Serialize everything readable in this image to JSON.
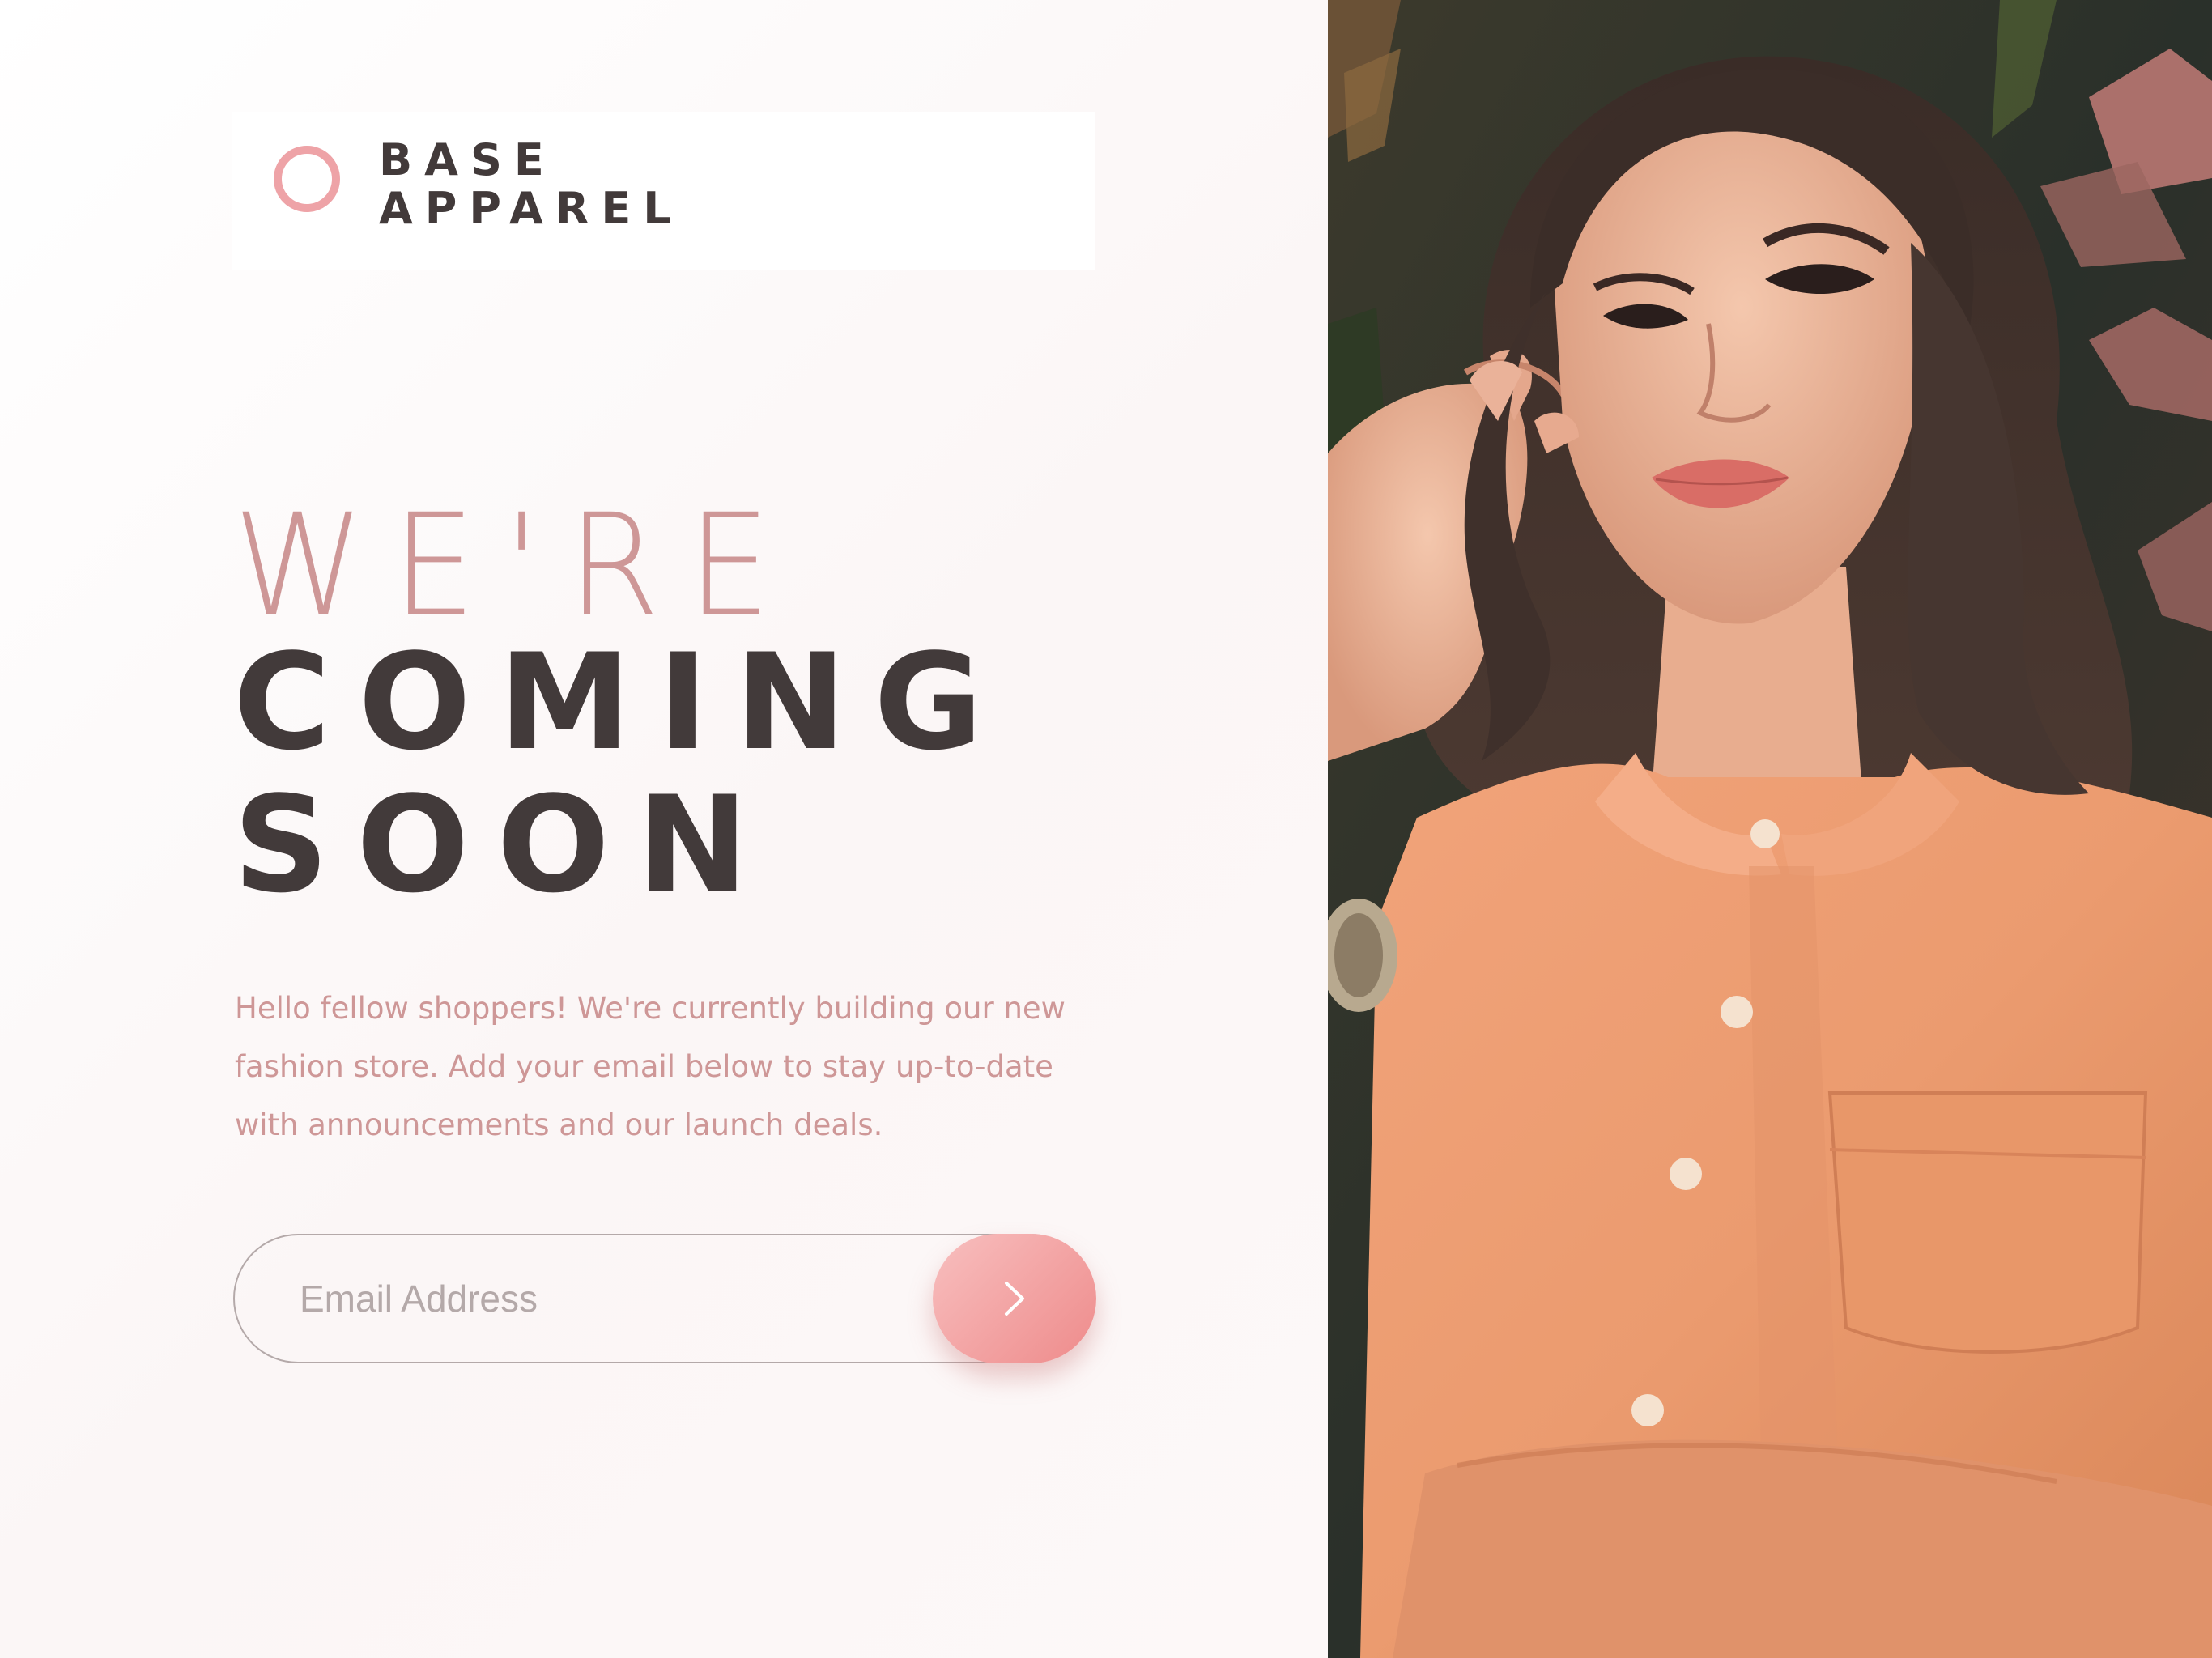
{
  "brand": {
    "line1": "BASE",
    "line2": "APPAREL",
    "accent_color": "#eea3a7",
    "text_color": "#423a3a"
  },
  "hero": {
    "line1": "WE'RE",
    "line2": "COMING",
    "line3": "SOON",
    "line1_color": "#ce9797",
    "line2_color": "#423a3a"
  },
  "intro": {
    "text": "Hello fellow shoppers! We're currently building our new fashion store. Add your email below to stay up-to-date with announcements and our launch deals."
  },
  "form": {
    "email_placeholder": "Email Address",
    "email_value": "",
    "submit_icon": "chevron-right-icon",
    "button_gradient": [
      "#f8bfbf",
      "#ee8b8b"
    ]
  },
  "hero_image": {
    "subject": "woman in peach button-up shirt",
    "icon": "model-photo"
  }
}
